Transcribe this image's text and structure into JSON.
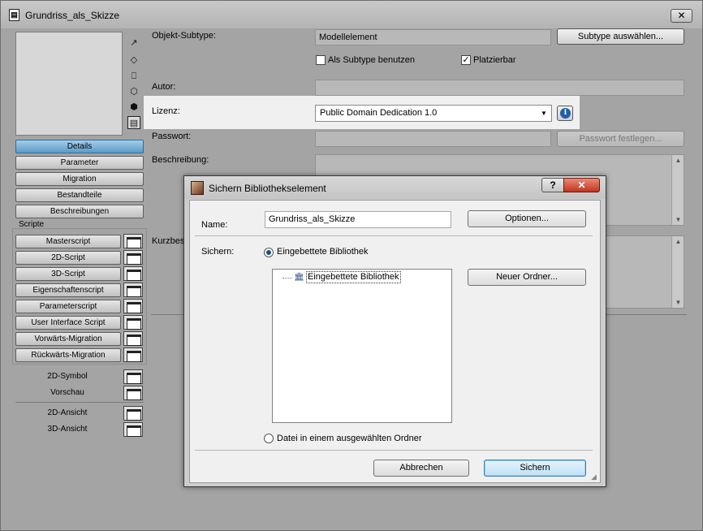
{
  "window": {
    "title": "Grundriss_als_Skizze",
    "close_glyph": "✕"
  },
  "view_icons": [
    "↗",
    "◇",
    "⎕",
    "⬡",
    "⬢",
    "▤"
  ],
  "nav": {
    "details": "Details",
    "parameter": "Parameter",
    "migration": "Migration",
    "bestandteile": "Bestandteile",
    "beschreibungen": "Beschreibungen"
  },
  "scripts": {
    "section_label": "Scripte",
    "items": [
      "Masterscript",
      "2D-Script",
      "3D-Script",
      "Eigenschaftenscript",
      "Parameterscript",
      "User Interface Script",
      "Vorwärts-Migration",
      "Rückwärts-Migration"
    ],
    "extra": [
      "2D-Symbol",
      "Vorschau",
      "2D-Ansicht",
      "3D-Ansicht"
    ]
  },
  "details": {
    "subtype_label": "Objekt-Subtype:",
    "subtype_value": "Modellelement",
    "subtype_button": "Subtype auswählen...",
    "as_subtype_label": "Als Subtype benutzen",
    "as_subtype_checked": false,
    "placeable_label": "Platzierbar",
    "placeable_checked": true,
    "author_label": "Autor:",
    "author_value": "",
    "license_label": "Lizenz:",
    "license_value": "Public Domain Dedication 1.0",
    "password_label": "Passwort:",
    "password_button": "Passwort festlegen...",
    "description_label": "Beschreibung:",
    "short_description_label": "Kurzbesch"
  },
  "dialog": {
    "title": "Sichern Bibliothekselement",
    "help_glyph": "?",
    "close_glyph": "✕",
    "name_label": "Name:",
    "name_value": "Grundriss_als_Skizze",
    "options_button": "Optionen...",
    "save_label": "Sichern:",
    "radio_embedded": "Eingebettete Bibliothek",
    "radio_embedded_selected": true,
    "tree_node": "Eingebettete Bibliothek",
    "new_folder_button": "Neuer Ordner...",
    "radio_folder": "Datei in einem ausgewählten Ordner",
    "radio_folder_selected": false,
    "cancel_button": "Abbrechen",
    "save_button": "Sichern"
  },
  "colors": {
    "window_bg": "#a4a4a4",
    "active_nav": "#5a9ac8",
    "close_red": "#c2341e",
    "info_blue": "#1f5fa8"
  }
}
